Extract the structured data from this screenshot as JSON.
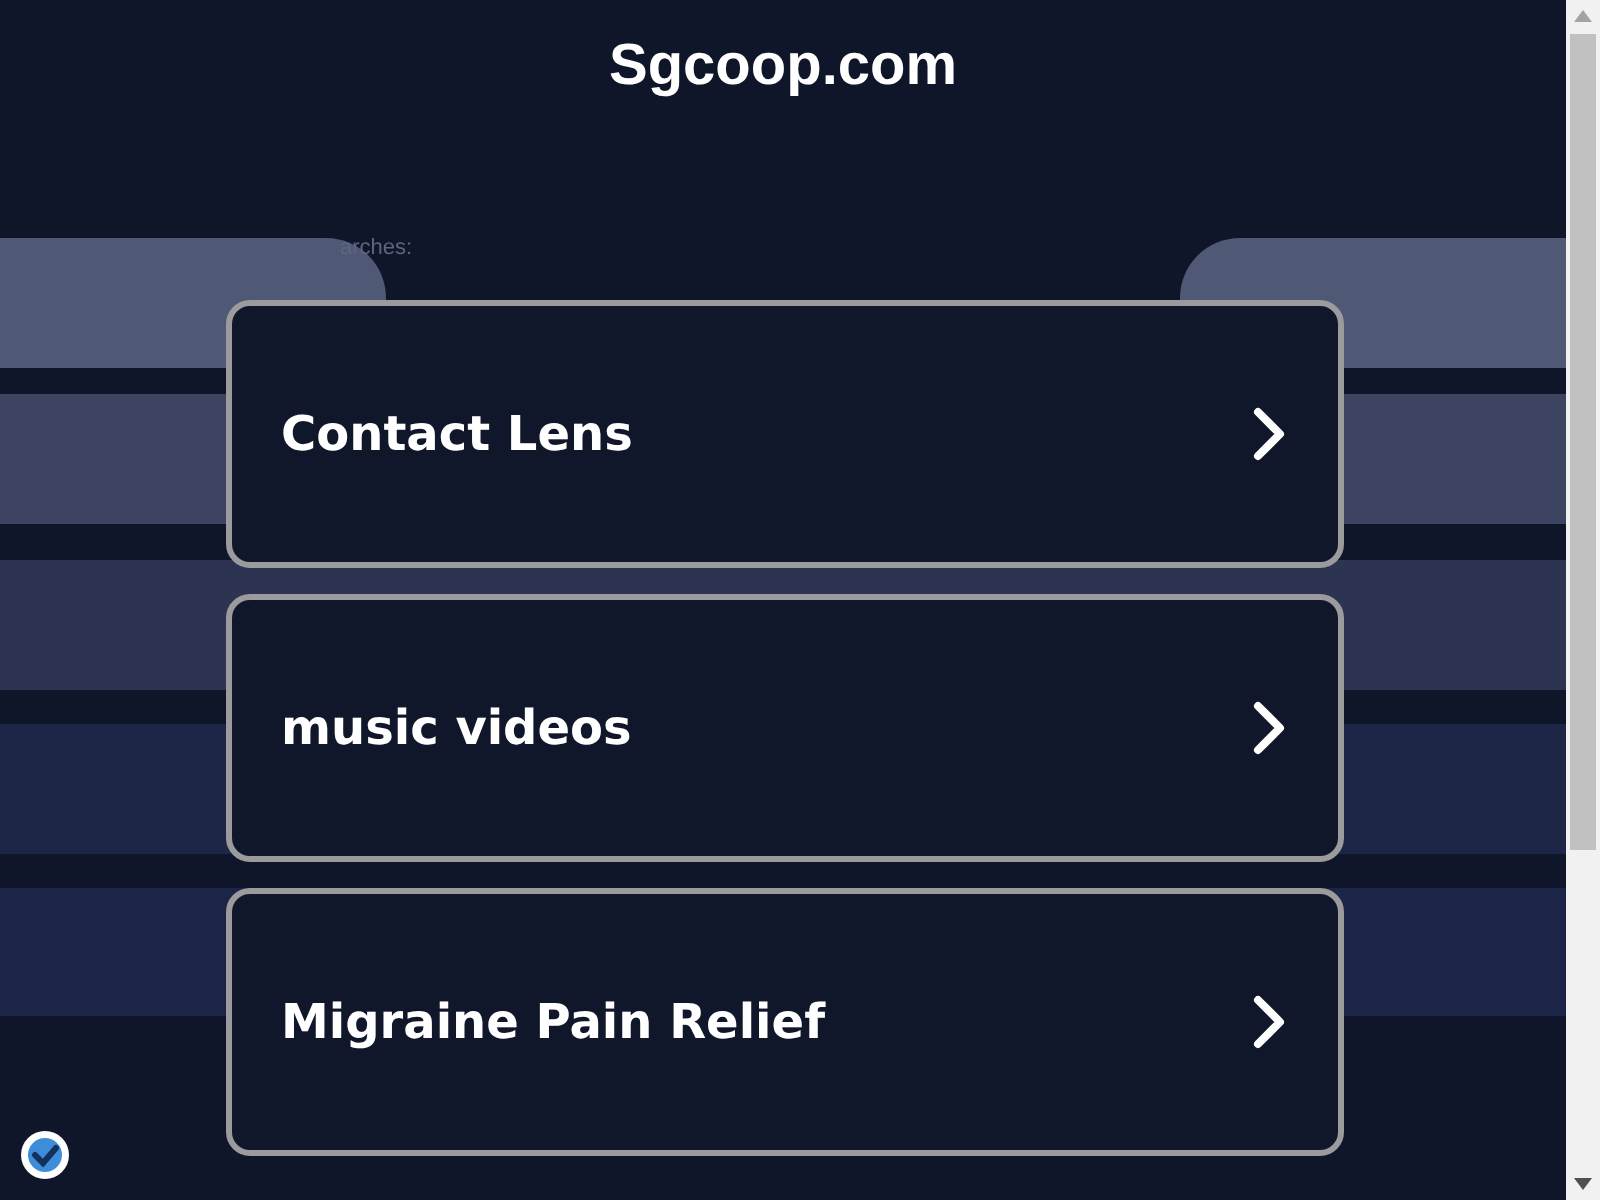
{
  "header": {
    "title": "Sgcoop.com"
  },
  "related": {
    "label": "arches:"
  },
  "links": [
    {
      "label": "Contact Lens"
    },
    {
      "label": "music videos"
    },
    {
      "label": "Migraine Pain Relief"
    }
  ]
}
